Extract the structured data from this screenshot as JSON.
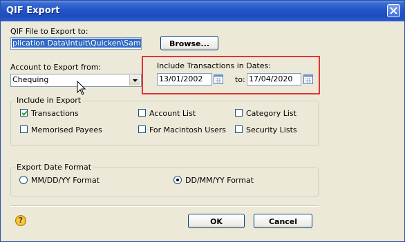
{
  "window": {
    "title": "QIF Export"
  },
  "file": {
    "label": "QIF File to Export to:",
    "path_value": "plication Data\\Intuit\\Quicken\\Sample\\",
    "browse_label": "Browse..."
  },
  "account": {
    "label": "Account to Export from:",
    "selected": "Chequing"
  },
  "dates": {
    "label": "Include Transactions in Dates:",
    "from": "13/01/2002",
    "to_label": "to:",
    "to": "17/04/2020"
  },
  "include": {
    "title": "Include in Export",
    "items": [
      {
        "label": "Transactions",
        "checked": true
      },
      {
        "label": "Account List",
        "checked": false
      },
      {
        "label": "Category List",
        "checked": false
      },
      {
        "label": "Memorised Payees",
        "checked": false
      },
      {
        "label": "For Macintosh Users",
        "checked": false
      },
      {
        "label": "Security Lists",
        "checked": false
      }
    ]
  },
  "date_format": {
    "title": "Export Date Format",
    "options": [
      {
        "label": "MM/DD/YY Format",
        "selected": false
      },
      {
        "label": "DD/MM/YY Format",
        "selected": true
      }
    ]
  },
  "footer": {
    "help_symbol": "?",
    "ok_label": "OK",
    "cancel_label": "Cancel"
  },
  "colors": {
    "title_bar": "#2455c8",
    "highlight": "#e03434",
    "dialog_bg": "#ece9d8"
  }
}
